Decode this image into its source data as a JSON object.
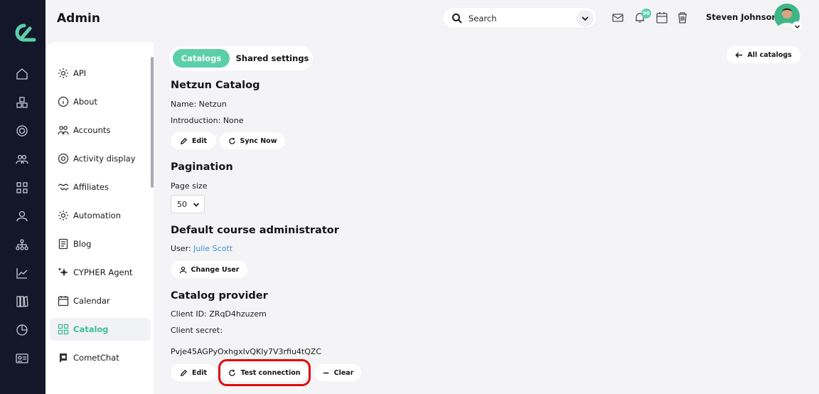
{
  "app": {
    "title": "Admin"
  },
  "header": {
    "search_label": "Search",
    "notification_count": "90",
    "user_name": "Steven Johnson"
  },
  "rail": {
    "icons": [
      "home-icon",
      "cubes-icon",
      "target-icon",
      "users-icon",
      "grid-icon",
      "user-icon",
      "hierarchy-icon",
      "chart-icon",
      "library-icon",
      "pie-icon",
      "id-card-icon"
    ]
  },
  "sidebar": {
    "items": [
      {
        "label": "API",
        "icon": "gear-icon"
      },
      {
        "label": "About",
        "icon": "info-icon"
      },
      {
        "label": "Accounts",
        "icon": "users-icon"
      },
      {
        "label": "Activity display",
        "icon": "target-icon"
      },
      {
        "label": "Affiliates",
        "icon": "handshake-icon"
      },
      {
        "label": "Automation",
        "icon": "gear-icon"
      },
      {
        "label": "Blog",
        "icon": "document-icon"
      },
      {
        "label": "CYPHER Agent",
        "icon": "sparkle-icon"
      },
      {
        "label": "Calendar",
        "icon": "calendar-icon"
      },
      {
        "label": "Catalog",
        "icon": "grid-icon"
      },
      {
        "label": "CometChat",
        "icon": "chat-icon"
      }
    ],
    "active": "Catalog"
  },
  "tabs": {
    "catalogs": "Catalogs",
    "shared": "Shared settings"
  },
  "all_catalogs_label": "All catalogs",
  "catalog": {
    "title": "Netzun Catalog",
    "name_line": "Name: Netzun",
    "intro_line": "Introduction: None",
    "edit_label": "Edit",
    "sync_label": "Sync Now"
  },
  "pagination": {
    "title": "Pagination",
    "page_size_label": "Page size",
    "page_size_value": "50"
  },
  "course_admin": {
    "title": "Default course administrator",
    "user_prefix": "User: ",
    "user_name": "Julie Scott",
    "change_label": "Change User"
  },
  "provider": {
    "title": "Catalog provider",
    "client_id_line": "Client ID: ZRqD4hzuzem",
    "client_secret_label": "Client secret:",
    "client_secret_value": "Pvje45AGPyOxhgxIvQKIy7V3rfiu4tQZC",
    "edit_label": "Edit",
    "test_label": "Test connection",
    "clear_label": "Clear"
  },
  "colors": {
    "accent": "#5ccfa8",
    "rail": "#14172a",
    "link": "#3b8fd6",
    "highlight": "#e00b0b"
  }
}
